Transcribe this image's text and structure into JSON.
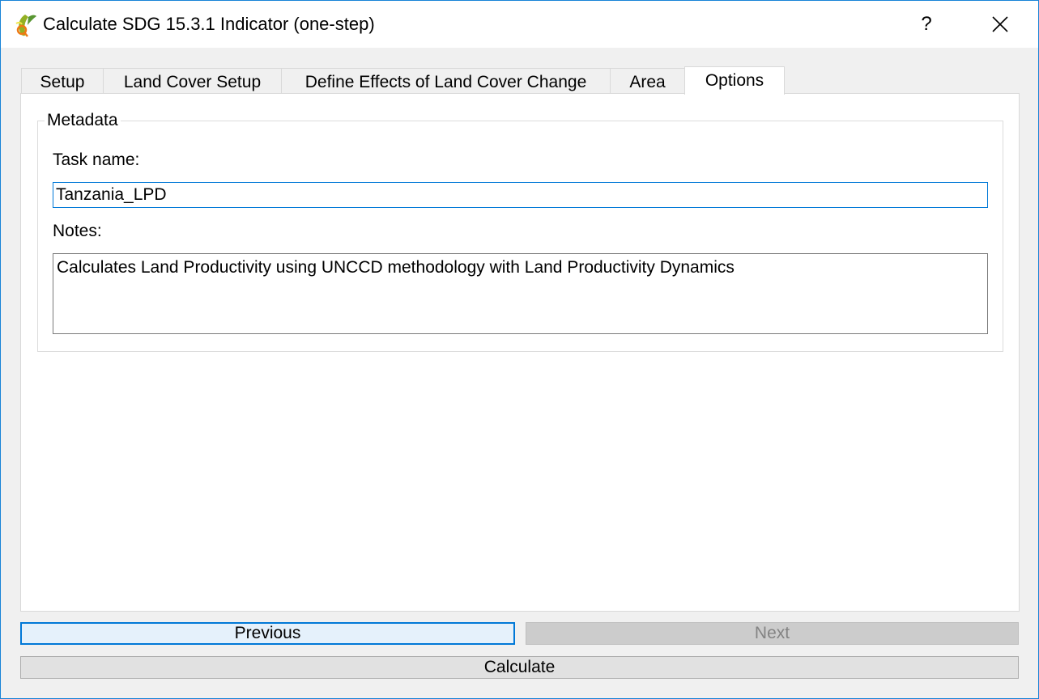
{
  "window": {
    "title": "Calculate SDG 15.3.1 Indicator (one-step)",
    "help_label": "?",
    "accent_color": "#0078d7"
  },
  "tabs": [
    {
      "label": "Setup",
      "active": false
    },
    {
      "label": "Land Cover Setup",
      "active": false
    },
    {
      "label": "Define Effects of Land Cover Change",
      "active": false
    },
    {
      "label": "Area",
      "active": false
    },
    {
      "label": "Options",
      "active": true
    }
  ],
  "metadata": {
    "group_title": "Metadata",
    "task_name_label": "Task name:",
    "task_name_value": "Tanzania_LPD",
    "notes_label": "Notes:",
    "notes_value": "Calculates Land Productivity using UNCCD methodology with Land Productivity Dynamics"
  },
  "buttons": {
    "previous_label": "Previous",
    "next_label": "Next",
    "calculate_label": "Calculate"
  }
}
